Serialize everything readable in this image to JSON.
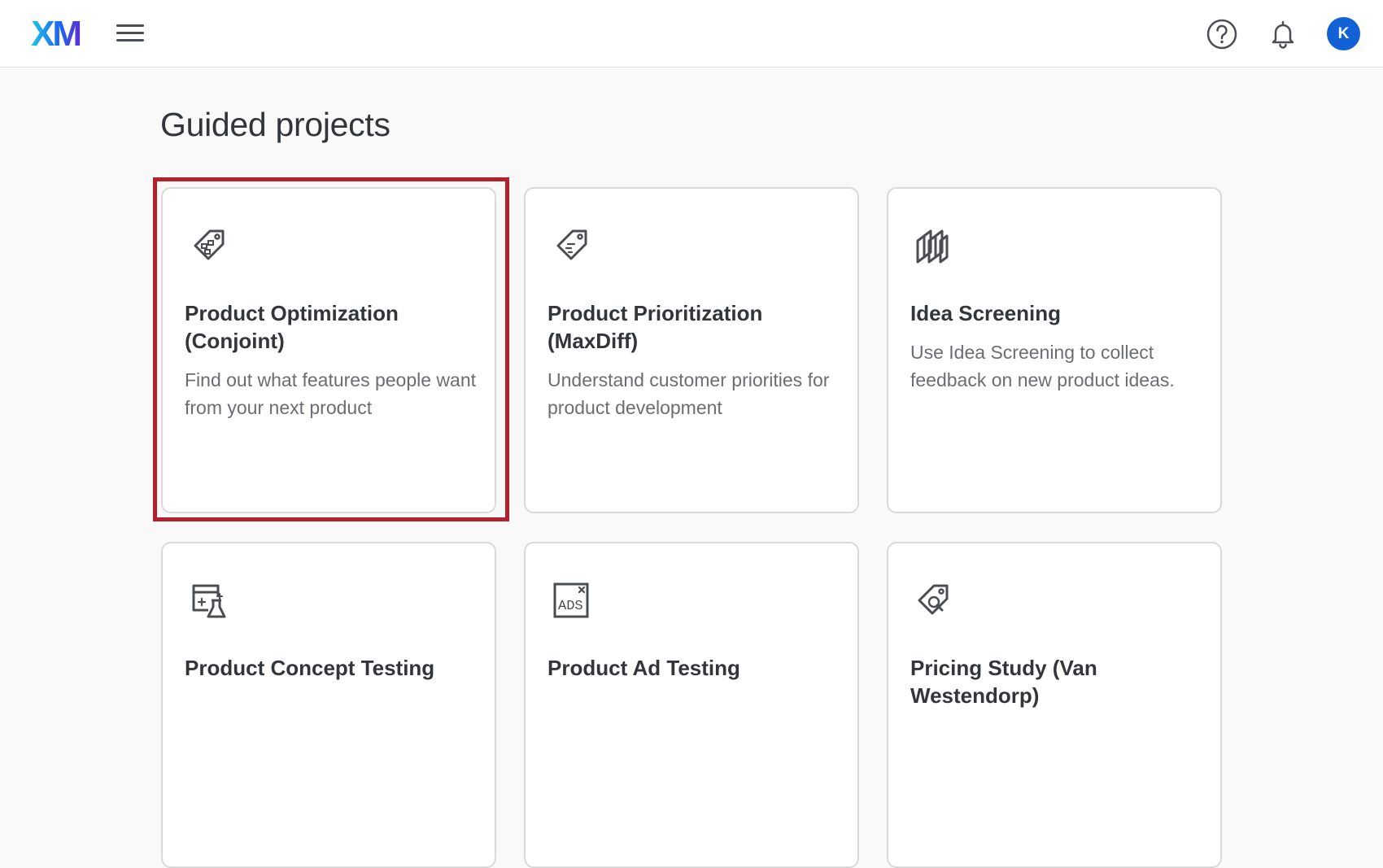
{
  "header": {
    "logo_text": "XM",
    "logo_gradient": [
      "#21c6e8",
      "#1a6cf0",
      "#5a2fd6"
    ],
    "menu_icon": "hamburger-menu-icon",
    "help_icon": "help-circle-icon",
    "notifications_icon": "bell-icon",
    "avatar_initial": "K",
    "avatar_color": "#1262d6"
  },
  "page": {
    "title": "Guided projects"
  },
  "projects": [
    {
      "title_line1": "Product Optimization",
      "title_line2": "(Conjoint)",
      "description": "Find out what features people want from your next product",
      "icon": "price-tag-grid-icon",
      "selected": true
    },
    {
      "title_line1": "Product Prioritization",
      "title_line2": "(MaxDiff)",
      "description": "Understand customer priorities for product development",
      "icon": "price-tag-lines-icon",
      "selected": false
    },
    {
      "title_line1": "Idea Screening",
      "title_line2": "",
      "description": "Use Idea Screening to collect feedback on new product ideas.",
      "icon": "stacked-cards-icon",
      "selected": false
    },
    {
      "title_line1": "Product Concept Testing",
      "title_line2": "",
      "description": "",
      "icon": "concept-flask-icon",
      "selected": false
    },
    {
      "title_line1": "Product Ad Testing",
      "title_line2": "",
      "description": "",
      "icon": "ads-icon",
      "icon_text": "ADS",
      "selected": false
    },
    {
      "title_line1": "Pricing Study (Van",
      "title_line2": "Westendorp)",
      "description": "",
      "icon": "price-tag-search-icon",
      "selected": false
    }
  ],
  "highlight_color": "#b5202f"
}
